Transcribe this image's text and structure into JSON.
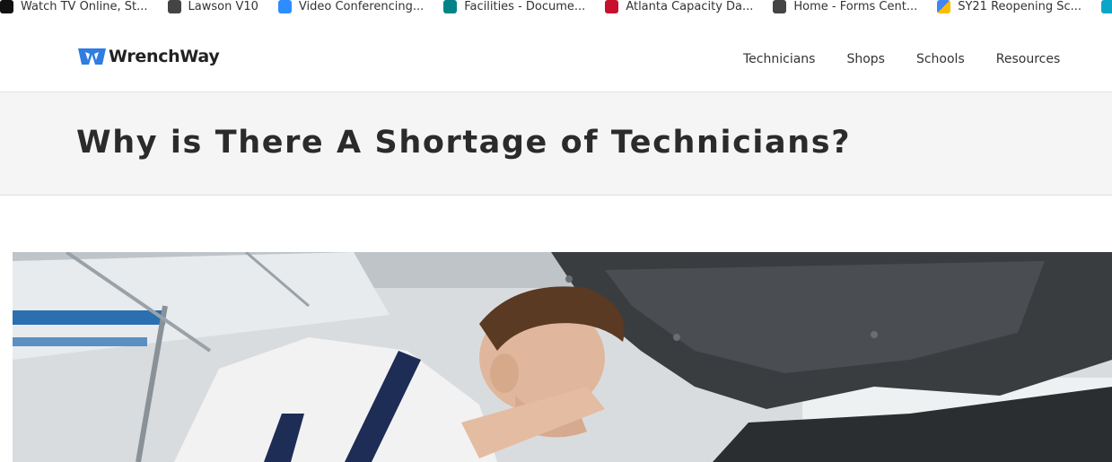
{
  "bookmarks": [
    {
      "label": "Watch TV Online, St...",
      "icon": "tv-icon"
    },
    {
      "label": "Lawson V10",
      "icon": "globe-icon"
    },
    {
      "label": "Video Conferencing...",
      "icon": "zoom-icon"
    },
    {
      "label": "Facilities - Docume...",
      "icon": "sharepoint-icon"
    },
    {
      "label": "Atlanta Capacity Da...",
      "icon": "red-logo-icon"
    },
    {
      "label": "Home - Forms Cent...",
      "icon": "globe-icon"
    },
    {
      "label": "SY21 Reopening Sc...",
      "icon": "colorful-logo-icon"
    }
  ],
  "site": {
    "brand": "WrenchWay",
    "brand_color": "#2f7de1"
  },
  "nav": {
    "items": [
      "Technicians",
      "Shops",
      "Schools",
      "Resources"
    ]
  },
  "page": {
    "title": "Why is There A Shortage of Technicians?"
  },
  "hero": {
    "image_alt": "Young mechanic working under open car hood"
  }
}
